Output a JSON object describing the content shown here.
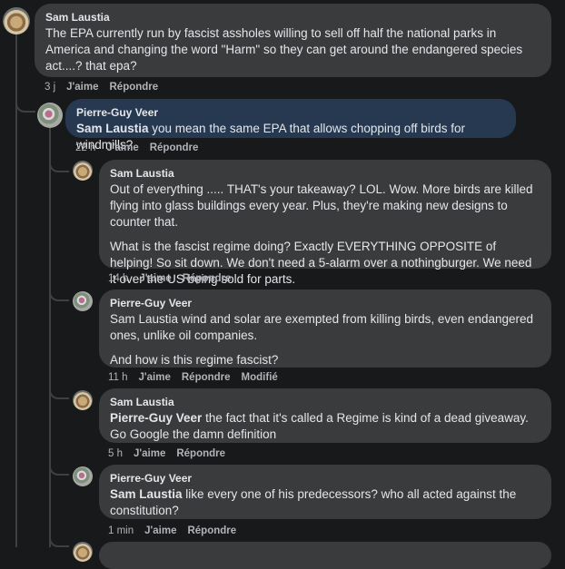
{
  "comments": [
    {
      "author": "Sam Laustia",
      "paragraphs": [
        "The EPA currently run by fascist assholes willing to sell off half the national parks in America and changing the word \"Harm\" so they can get around the endangered species act....? that epa?"
      ],
      "time": "3 j",
      "like": "J'aime",
      "reply": "Répondre"
    },
    {
      "author": "Pierre-Guy Veer",
      "mention": "Sam Laustia",
      "text": " you mean the same EPA that allows chopping off birds for windmills?",
      "time": "22 h",
      "like": "J'aime",
      "reply": "Répondre"
    },
    {
      "author": "Sam Laustia",
      "paragraphs": [
        "Out of everything ..... THAT's your takeaway? LOL. Wow. More birds are killed flying into glass buildings every year. Plus, they're making new designs to counter that.",
        "What is the fascist regime doing? Exactly EVERYTHING OPPOSITE of helping! So sit down. We don't need a 5-alarm over a nothingburger. We need it over the US being sold for parts."
      ],
      "time": "14 h",
      "like": "J'aime",
      "reply": "Répondre"
    },
    {
      "author": "Pierre-Guy Veer",
      "paragraphs": [
        "Sam Laustia wind and solar are exempted from killing birds, even endangered ones, unlike oil companies.",
        "And how is this regime fascist?"
      ],
      "time": "11 h",
      "like": "J'aime",
      "reply": "Répondre",
      "edited": "Modifié"
    },
    {
      "author": "Sam Laustia",
      "mention": "Pierre-Guy Veer",
      "text": " the fact that it's called a Regime is kind of a dead giveaway. Go Google the damn definition",
      "time": "5 h",
      "like": "J'aime",
      "reply": "Répondre"
    },
    {
      "author": "Pierre-Guy Veer",
      "mention": "Sam Laustia",
      "text": " like every one of his predecessors? who all acted against the constitution?",
      "time": "1 min",
      "like": "J'aime",
      "reply": "Répondre"
    }
  ],
  "colors": {
    "bubble": "#3a3b3c",
    "highlight": "#263951",
    "background": "#18191a"
  },
  "icons": [
    "avatar-sam-laustia",
    "avatar-pierre-guy-veer"
  ]
}
